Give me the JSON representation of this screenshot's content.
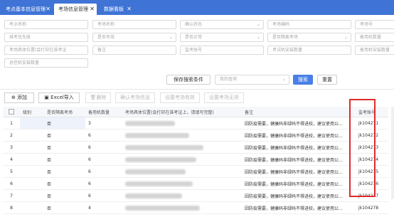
{
  "tabs": [
    {
      "label": "考点基本信息管理",
      "active": false
    },
    {
      "label": "考场信息管理",
      "active": true
    },
    {
      "label": "数据看板",
      "active": false
    }
  ],
  "filters": {
    "row1": [
      "考点名称",
      "考场名称",
      "确认状态",
      "考场编码",
      "考场号"
    ],
    "row2": [
      "排考优先级",
      "是否有效",
      "是否正常",
      "是否隔离考场",
      "备用机数量"
    ],
    "row3": [
      "考场具体位置(会打印在准考证",
      "备注",
      "监考账号",
      "考试机安装数量",
      "备用机安装数量"
    ],
    "row4": [
      "总控机安装数量"
    ]
  },
  "search": {
    "save_label": "保存搜索条件",
    "query_placeholder": "我的查询",
    "search_label": "搜索",
    "reset_label": "重置"
  },
  "toolbar": {
    "add": "添加",
    "excel": "Excel导入",
    "delete": "删除",
    "confirm": "确认考场信息",
    "valid": "设置考场有效",
    "invalid": "设置考场无效"
  },
  "table": {
    "headers": [
      "",
      "级别",
      "是否隔离考场",
      "备用机数量",
      "考场具体位置(会打印在准考证上，请填写完整)",
      "备注",
      "监考账号"
    ],
    "rows": [
      {
        "idx": "1",
        "isolate": "否",
        "spare": "3",
        "remark": "因防疫需要，健康码非绿码不得进校，建议使用公...",
        "account": "jk104271"
      },
      {
        "idx": "2",
        "isolate": "否",
        "spare": "6",
        "remark": "因防疫需要，健康码非绿码不得进校，建议使用公...",
        "account": "jk104272"
      },
      {
        "idx": "3",
        "isolate": "否",
        "spare": "6",
        "remark": "因防疫需要，健康码非绿码不得进校，建议使用公...",
        "account": "jk104273"
      },
      {
        "idx": "4",
        "isolate": "否",
        "spare": "6",
        "remark": "因防疫需要，健康码非绿码不得进校，建议使用公...",
        "account": "jk104274"
      },
      {
        "idx": "5",
        "isolate": "否",
        "spare": "6",
        "remark": "因防疫需要，健康码非绿码不得进校，建议使用公...",
        "account": "jk104275"
      },
      {
        "idx": "6",
        "isolate": "否",
        "spare": "6",
        "remark": "因防疫需要，健康码非绿码不得进校，建议使用公...",
        "account": "jk104276"
      },
      {
        "idx": "7",
        "isolate": "否",
        "spare": "6",
        "remark": "因防疫需要，健康码非绿码不得进校，建议使用公...",
        "account": "jk104277"
      },
      {
        "idx": "8",
        "isolate": "否",
        "spare": "4",
        "remark": "因防疫需要，健康码非绿码不得进校，建议使用公...",
        "account": "jk104278"
      }
    ]
  },
  "colors": {
    "accent": "#3f74d6",
    "highlight": "#e02a2a"
  }
}
